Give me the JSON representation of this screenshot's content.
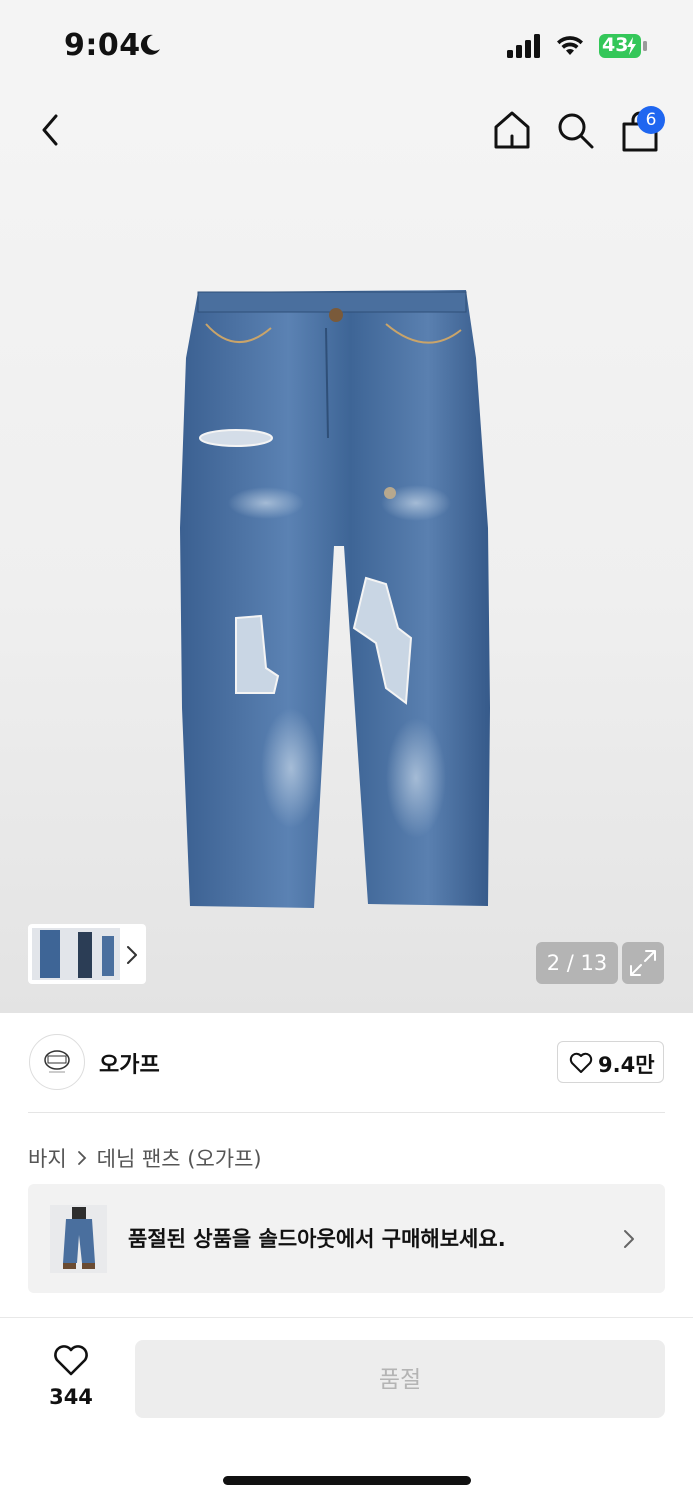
{
  "status_bar": {
    "time": "9:04",
    "battery": "43",
    "icons": [
      "moon-icon",
      "signal-icon",
      "wifi-icon",
      "battery-charging-icon"
    ]
  },
  "nav": {
    "icons": [
      "chevron-left-icon",
      "home-icon",
      "search-icon",
      "shopping-bag-icon"
    ],
    "cart_count": "6"
  },
  "gallery": {
    "counter": "2 / 13",
    "icons": [
      "expand-icon",
      "chevron-right-icon"
    ]
  },
  "brand": {
    "name": "오가프",
    "like_count": "9.4만"
  },
  "breadcrumb": {
    "category": "바지",
    "subcategory": "데님 팬츠 (오가프)"
  },
  "banner": {
    "text": "품절된 상품을 솔드아웃에서 구매해보세요."
  },
  "bottom_bar": {
    "wish_count": "344",
    "soldout_label": "품절"
  },
  "colors": {
    "accent": "#1f66f0",
    "battery_green": "#34c759",
    "denim": "#4a6f9e"
  }
}
